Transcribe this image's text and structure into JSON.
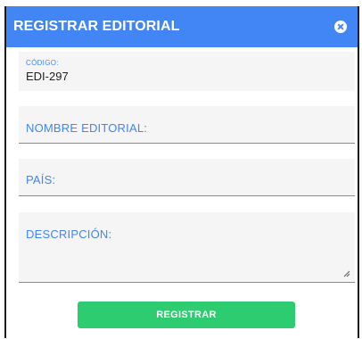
{
  "dialog": {
    "title": "REGISTRAR EDITORIAL",
    "close_icon": "close-circle-icon"
  },
  "form": {
    "codigo": {
      "label": "CÓDIGO:",
      "value": "EDI-297"
    },
    "nombre": {
      "label": "NOMBRE EDITORIAL:",
      "value": ""
    },
    "pais": {
      "label": "PAÍS:",
      "value": ""
    },
    "descripcion": {
      "label": "DESCRIPCIÓN:",
      "value": ""
    }
  },
  "actions": {
    "register_label": "REGISTRAR"
  },
  "colors": {
    "header": "#4285f4",
    "label": "#4285f4",
    "field_bg": "#f5f5f5",
    "button": "#2ecc71"
  }
}
